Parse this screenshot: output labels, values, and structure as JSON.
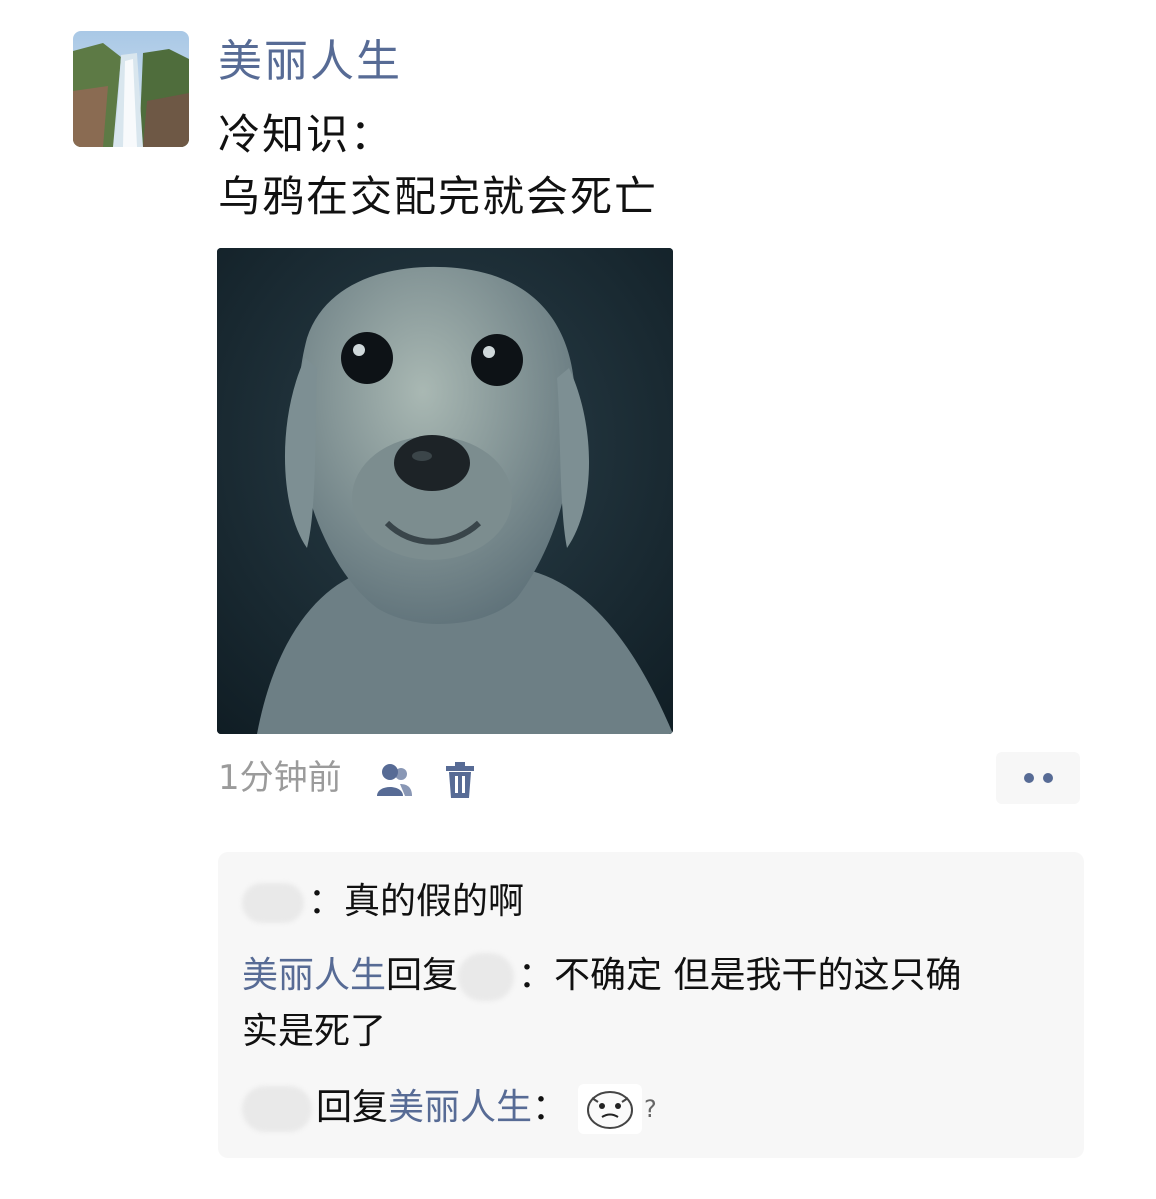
{
  "post": {
    "username": "美丽人生",
    "text_line1": "冷知识：",
    "text_line2": "乌鸦在交配完就会死亡",
    "time": "1分钟前",
    "icons": {
      "privacy": "user-group-icon",
      "delete": "trash-icon",
      "more": "more-dots-icon"
    }
  },
  "comments": [
    {
      "author": "",
      "text": "：真的假的啊"
    },
    {
      "author": "美丽人生",
      "reply_word": "回复",
      "target": "",
      "text": "：不确定 但是我干的这只确",
      "text_cont": "实是死了"
    },
    {
      "author": "",
      "reply_word": "回复",
      "target": "美丽人生",
      "text": "：",
      "suffix": "?"
    }
  ],
  "colors": {
    "link": "#576b95",
    "meta": "#9b9b9b",
    "comment_bg": "#f7f7f7"
  }
}
